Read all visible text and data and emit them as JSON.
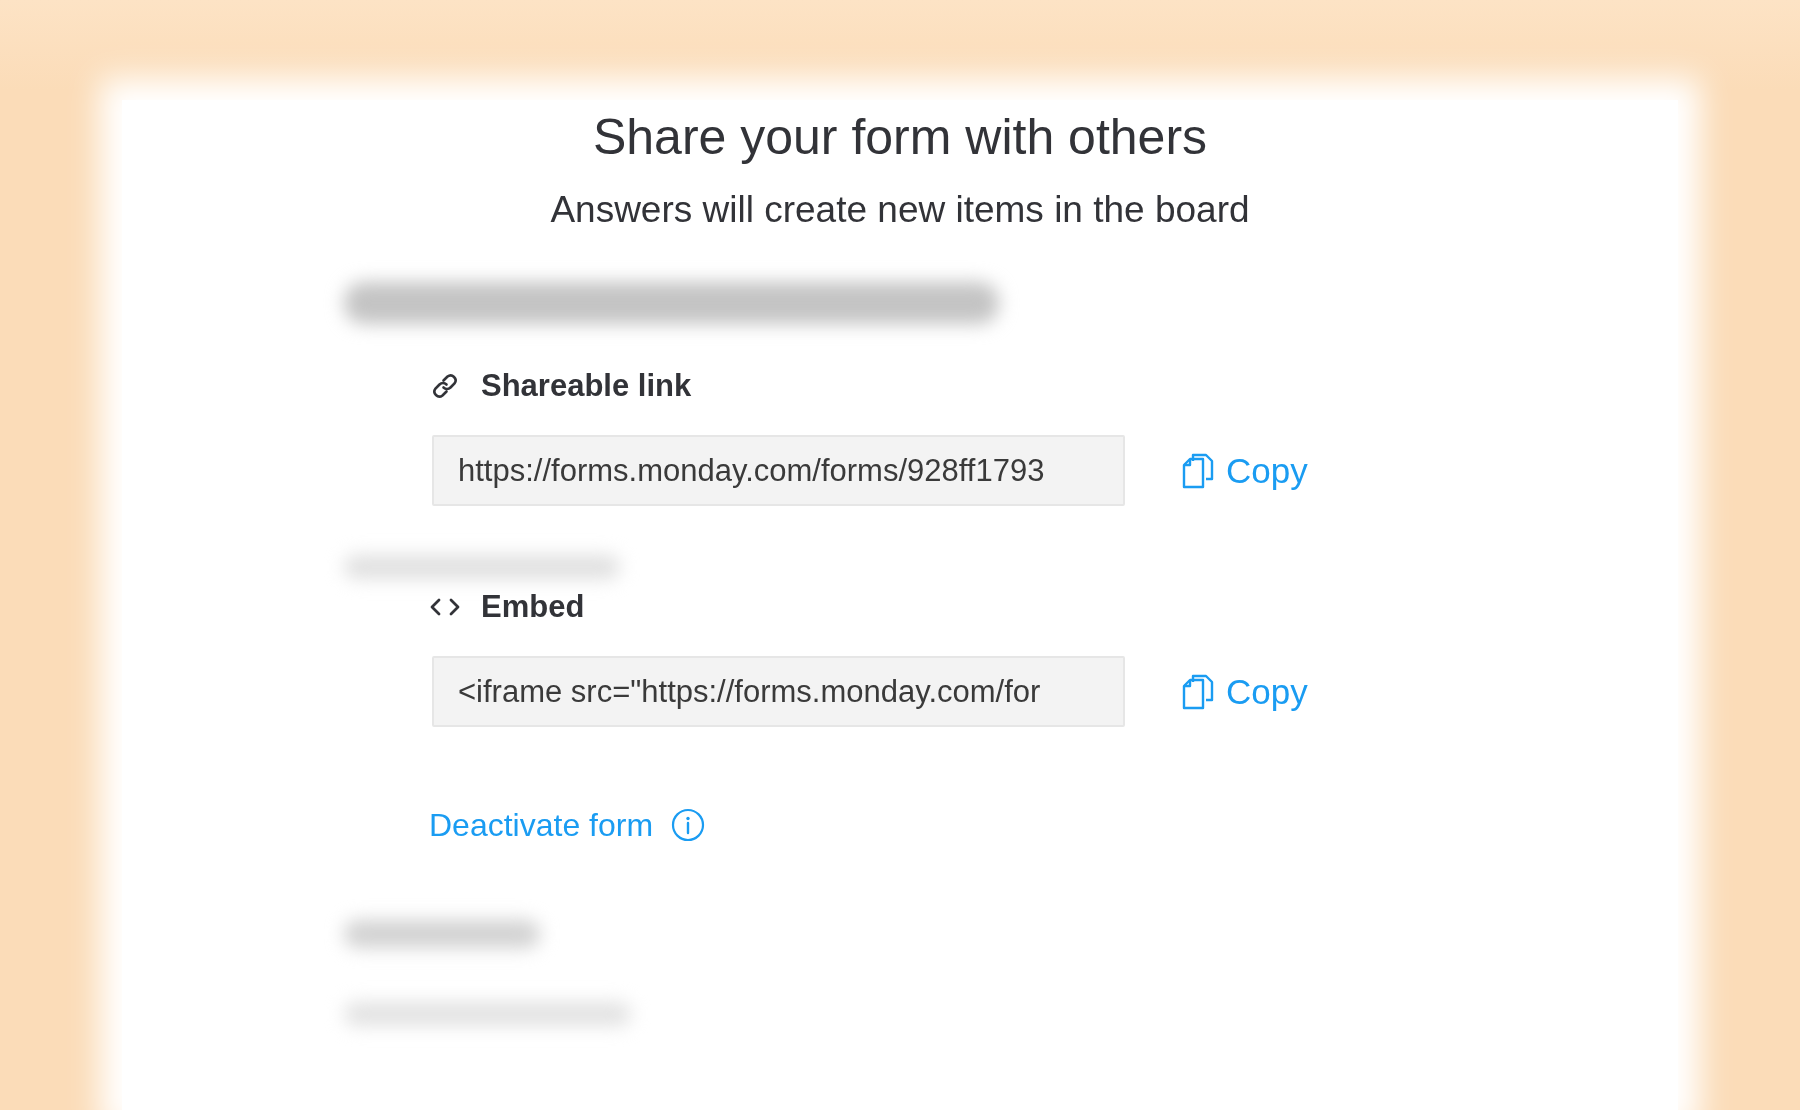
{
  "dialog": {
    "title": "Share your form with others",
    "subtitle": "Answers will create new items in the board"
  },
  "sections": [
    {
      "kind": "link",
      "heading": "Shareable link",
      "field_value": "https://forms.monday.com/forms/928ff1793",
      "copy_button": "Copy"
    },
    {
      "kind": "embed",
      "heading": "Embed",
      "field_value": "<iframe src=\"https://forms.monday.com/for",
      "copy_button": "Copy"
    }
  ],
  "deactivate_link": "Deactivate form"
}
